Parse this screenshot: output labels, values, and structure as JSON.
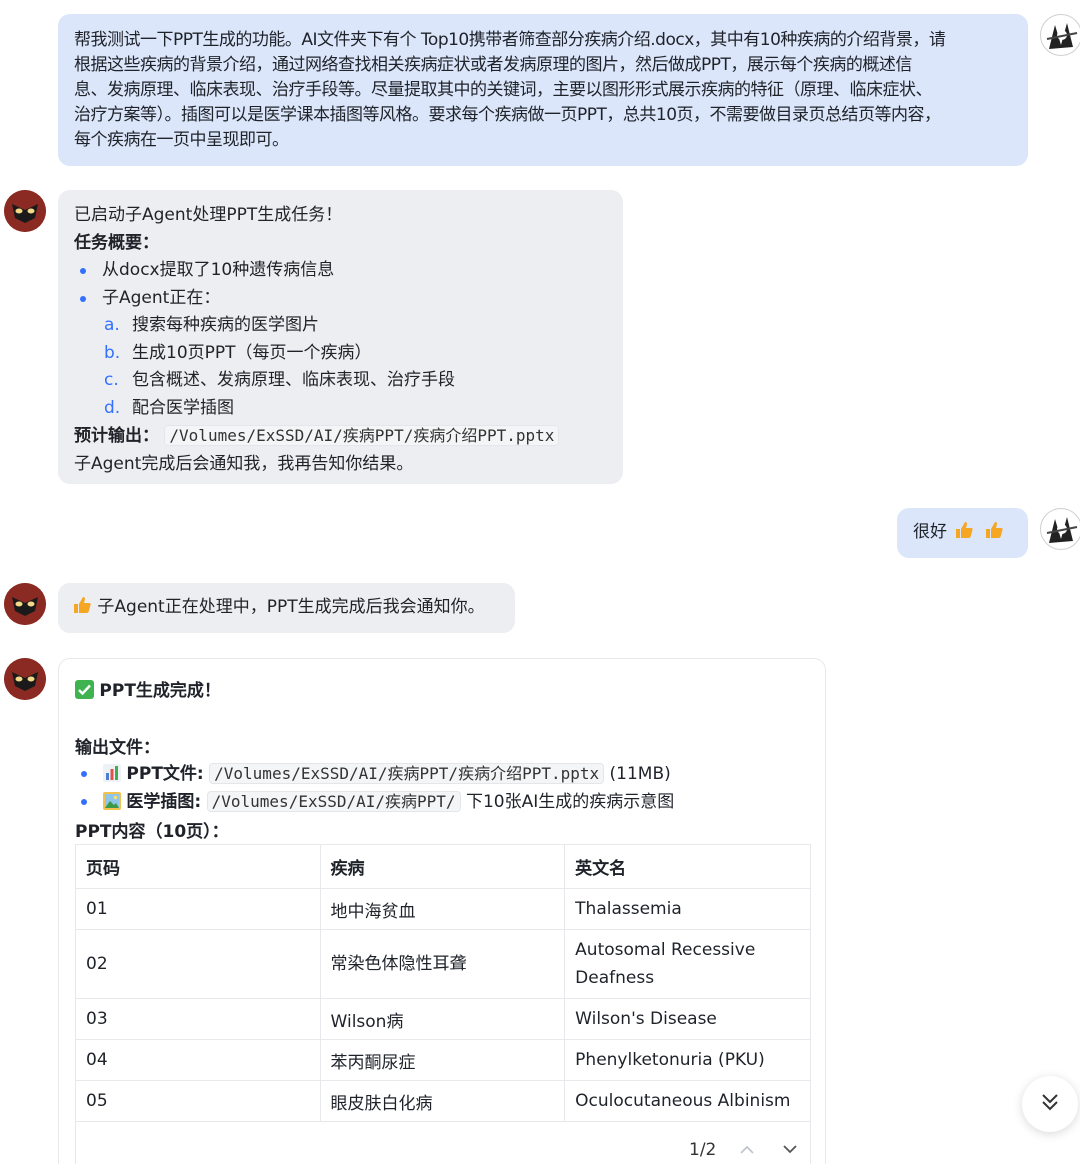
{
  "messages": {
    "m1_user": {
      "lines": [
        "帮我测试一下PPT生成的功能。AI文件夹下有个 Top10携带者筛查部分疾病介绍.docx，其中有10种疾病的介绍背景，请",
        "根据这些疾病的背景介绍，通过网络查找相关疾病症状或者发病原理的图片，然后做成PPT，展示每个疾病的概述信",
        "息、发病原理、临床表现、治疗手段等。尽量提取其中的关键词，主要以图形形式展示疾病的特征（原理、临床症状、",
        "治疗方案等）。插图可以是医学课本插图等风格。要求每个疾病做一页PPT，总共10页，不需要做目录页总结页等内容，",
        "每个疾病在一页中呈现即可。"
      ]
    },
    "m2_bot": {
      "intro": "已启动子Agent处理PPT生成任务！",
      "summary_label": "任务概要：",
      "bullets": [
        "从docx提取了10种遗传病信息",
        "子Agent正在："
      ],
      "sub_items": [
        {
          "marker": "a.",
          "text": "搜索每种疾病的医学图片"
        },
        {
          "marker": "b.",
          "text": "生成10页PPT（每页一个疾病）"
        },
        {
          "marker": "c.",
          "text": "包含概述、发病原理、临床表现、治疗手段"
        },
        {
          "marker": "d.",
          "text": "配合医学插图"
        }
      ],
      "output_label": "预计输出：",
      "output_path": "/Volumes/ExSSD/AI/疾病PPT/疾病介绍PPT.pptx",
      "closing": "子Agent完成后会通知我，我再告知你结果。"
    },
    "m3_user": {
      "text": "很好"
    },
    "m4_bot": {
      "text": "子Agent正在处理中，PPT生成完成后我会通知你。"
    },
    "m5_bot": {
      "title": "PPT生成完成！",
      "output_label": "输出文件：",
      "files": [
        {
          "label": "PPT文件:",
          "path": "/Volumes/ExSSD/AI/疾病PPT/疾病介绍PPT.pptx",
          "suffix": "(11MB)"
        },
        {
          "label": "医学插图:",
          "path": "/Volumes/ExSSD/AI/疾病PPT/",
          "suffix": "下10张AI生成的疾病示意图"
        }
      ],
      "content_label": "PPT内容（10页）：",
      "table": {
        "headers": [
          "页码",
          "疾病",
          "英文名"
        ],
        "rows": [
          [
            "01",
            "地中海贫血",
            "Thalassemia"
          ],
          [
            "02",
            "常染色体隐性耳聋",
            "Autosomal Recessive Deafness"
          ],
          [
            "03",
            "Wilson病",
            "Wilson's Disease"
          ],
          [
            "04",
            "苯丙酮尿症",
            "Phenylketonuria (PKU)"
          ],
          [
            "05",
            "眼皮肤白化病",
            "Oculocutaneous Albinism"
          ]
        ]
      },
      "pager": "1/2"
    }
  },
  "colors": {
    "user_bubble": "#dbe6fb",
    "bot_bubble": "#eceef1",
    "accent": "#3370ff",
    "bot_avatar": "#8a2a22"
  },
  "icons": {
    "thumbs_up": "thumbs-up-icon",
    "check": "check-mark-icon",
    "bar_chart": "bar-chart-icon",
    "picture": "picture-icon",
    "scroll_down": "double-chevron-down-icon",
    "page_up": "chevron-up-icon",
    "page_down": "chevron-down-icon"
  }
}
